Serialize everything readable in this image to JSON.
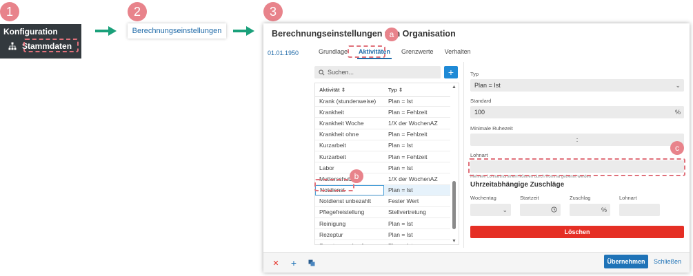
{
  "steps": {
    "s1": "1",
    "s2": "2",
    "s3": "3",
    "a": "a",
    "b": "b",
    "c": "c"
  },
  "nav": {
    "title": "Konfiguration",
    "item": "Stammdaten"
  },
  "breadcrumb": {
    "label": "Berechnungseinstellungen"
  },
  "dialog": {
    "title": "Berechnungseinstellungen von Organisation",
    "date": "01.01.1950",
    "tabs": [
      "Grundlage",
      "Aktivitäten",
      "Grenzwerte",
      "Verhalten"
    ],
    "search_placeholder": "Suchen...",
    "add_label": "+",
    "table": {
      "headers": [
        "Aktivität",
        "Typ"
      ],
      "rows": [
        [
          "Krank (stundenweise)",
          "Plan = Ist"
        ],
        [
          "Krankheit",
          "Plan = Fehlzeit"
        ],
        [
          "Krankheit Woche",
          "1/X der WochenAZ"
        ],
        [
          "Krankheit ohne",
          "Plan = Fehlzeit"
        ],
        [
          "Kurzarbeit",
          "Plan = Ist"
        ],
        [
          "Kurzarbeit",
          "Plan = Fehlzeit"
        ],
        [
          "Labor",
          "Plan = Ist"
        ],
        [
          "Mutterschutz",
          "1/X der WochenAZ"
        ],
        [
          "Notdienst",
          "Plan = Ist"
        ],
        [
          "Notdienst unbezahlt",
          "Fester Wert"
        ],
        [
          "Pflegefreistellung",
          "Stellvertretung"
        ],
        [
          "Reinigung",
          "Plan = Ist"
        ],
        [
          "Rezeptur",
          "Plan = Ist"
        ],
        [
          "Sonntagsverkauf",
          "Plan = Ist"
        ]
      ]
    },
    "form": {
      "typ_label": "Typ",
      "typ_value": "Plan = Ist",
      "standard_label": "Standard",
      "standard_value": "100",
      "standard_unit": "%",
      "ruhezeit_label": "Minimale Ruhezeit",
      "ruhezeit_value": ":",
      "lohnart_label": "Lohnart",
      "lohnart_value": "",
      "note": "Mehrere Lohnartnummern können durch Komma getrennt werden",
      "section_title": "Uhrzeitabhängige Zuschläge",
      "col_wochentag": "Wochentag",
      "col_startzeit": "Startzeit",
      "col_zuschlag": "Zuschlag",
      "col_zuschlag_unit": "%",
      "col_lohnart": "Lohnart",
      "delete_label": "Löschen"
    },
    "footer": {
      "ok_label": "Übernehmen",
      "close_label": "Schließen"
    }
  },
  "colors": {
    "accent": "#1f73b7",
    "danger": "#e52f25",
    "highlight": "#e0707a",
    "nav_bg": "#33393e"
  }
}
